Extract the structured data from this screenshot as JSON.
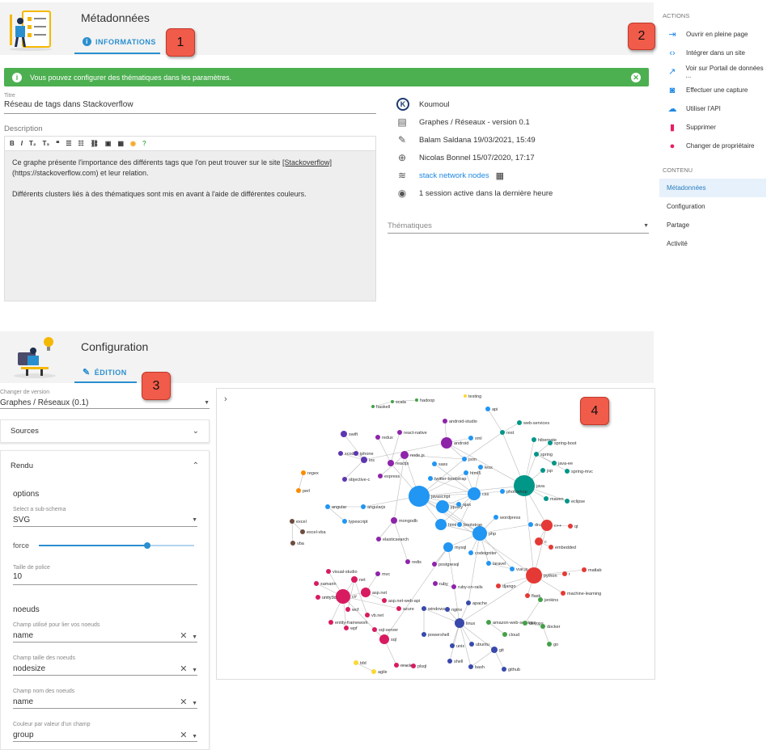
{
  "meta": {
    "header": {
      "title": "Métadonnées",
      "tab_label": "INFORMATIONS"
    },
    "callouts": [
      "1",
      "2",
      "3",
      "4"
    ],
    "alert": {
      "text": "Vous pouvez configurer des thématiques dans les paramètres."
    },
    "title_field": {
      "label": "Titre",
      "value": "Réseau de tags dans Stackoverflow"
    },
    "description": {
      "label": "Description",
      "toolbar": [
        "B",
        "I",
        "T₂",
        "T₃",
        "❝",
        "☰",
        "☷",
        "⛓",
        "▣",
        "▦",
        "◉",
        "?"
      ],
      "line1_before": "Ce graphe présente l'importance des différents tags que l'on peut trouver sur le site ",
      "line1_link": "[Stackoverflow]",
      "line1_after": "(https://stackoverflow.com) et leur relation.",
      "line2": "Différents clusters liés à des thématiques sont mis en avant à l'aide de différentes couleurs."
    },
    "info": {
      "owner": "Koumoul",
      "app": "Graphes / Réseaux - version 0.1",
      "updated": "Balam Saldana 19/03/2021, 15:49",
      "created": "Nicolas Bonnel 15/07/2020, 17:17",
      "dataset": "stack network nodes",
      "sessions": "1 session active dans la dernière heure",
      "thematiques_label": "Thématiques"
    }
  },
  "right": {
    "actions_header": "ACTIONS",
    "actions": [
      {
        "label": "Ouvrir en pleine page",
        "icon": "open-icon",
        "color": "#1e88e5"
      },
      {
        "label": "Intégrer dans un site",
        "icon": "code-icon",
        "color": "#1e88e5"
      },
      {
        "label": "Voir sur Portail de données ...",
        "icon": "external-link-icon",
        "color": "#1e88e5"
      },
      {
        "label": "Effectuer une capture",
        "icon": "camera-icon",
        "color": "#1e88e5"
      },
      {
        "label": "Utiliser l'API",
        "icon": "cloud-icon",
        "color": "#1e88e5"
      },
      {
        "label": "Supprimer",
        "icon": "delete-icon",
        "color": "#e91e63"
      },
      {
        "label": "Changer de propriétaire",
        "icon": "person-icon",
        "color": "#e91e63"
      }
    ],
    "content_header": "CONTENU",
    "content": [
      "Métadonnées",
      "Configuration",
      "Partage",
      "Activité"
    ]
  },
  "config": {
    "header": {
      "title": "Configuration",
      "tab_label": "ÉDITION"
    },
    "version": {
      "label": "Changer de version",
      "value": "Graphes / Réseaux (0.1)"
    },
    "sources_label": "Sources",
    "rendu_label": "Rendu",
    "options_label": "options",
    "subschema": {
      "label": "Select a sub-schema",
      "value": "SVG"
    },
    "force": {
      "label": "force",
      "level": 0.7
    },
    "font_size": {
      "label": "Taille de police",
      "value": "10"
    },
    "nodes_label": "noeuds",
    "field_link": {
      "label": "Champ utilisé pour lier vos noeuds",
      "value": "name"
    },
    "field_size": {
      "label": "Champ taille des noeuds",
      "value": "nodesize"
    },
    "field_name": {
      "label": "Champ nom des noeuds",
      "value": "name"
    },
    "field_color": {
      "label": "Couleur par valeur d'un champ",
      "value": "group"
    }
  },
  "graph": {
    "colors": {
      "web": "#2196f3",
      "front": "#8e24aa",
      "java": "#009688",
      "python": "#e53935",
      "dotnet": "#d81b60",
      "linux": "#3949ab",
      "cloud": "#43a047",
      "misc": "#fdd835",
      "gray": "#6d4c41",
      "ios": "#5e35b1",
      "orange": "#fb8c00"
    },
    "nodes": [
      {
        "name": "testing",
        "g": "misc"
      },
      {
        "name": "haskell",
        "g": "cloud"
      },
      {
        "name": "scala",
        "g": "cloud"
      },
      {
        "name": "hadoop",
        "g": "cloud"
      },
      {
        "name": "api",
        "g": "web"
      },
      {
        "name": "android-studio",
        "g": "front"
      },
      {
        "name": "web-services",
        "g": "java"
      },
      {
        "name": "swift",
        "g": "ios"
      },
      {
        "name": "react-native",
        "g": "front"
      },
      {
        "name": "xml",
        "g": "web"
      },
      {
        "name": "rest",
        "g": "java"
      },
      {
        "name": "redux",
        "g": "front"
      },
      {
        "name": "android",
        "g": "front"
      },
      {
        "name": "hibernate",
        "g": "java"
      },
      {
        "name": "spring-boot",
        "g": "java"
      },
      {
        "name": "xcode",
        "g": "ios"
      },
      {
        "name": "iphone",
        "g": "ios"
      },
      {
        "name": "node.js",
        "g": "front"
      },
      {
        "name": "json",
        "g": "web"
      },
      {
        "name": "spring",
        "g": "java"
      },
      {
        "name": "ios",
        "g": "ios"
      },
      {
        "name": "reactjs",
        "g": "front"
      },
      {
        "name": "sass",
        "g": "web"
      },
      {
        "name": "less",
        "g": "web"
      },
      {
        "name": "java-ee",
        "g": "java"
      },
      {
        "name": "html5",
        "g": "web"
      },
      {
        "name": "jsp",
        "g": "java"
      },
      {
        "name": "spring-mvc",
        "g": "java"
      },
      {
        "name": "regex",
        "g": "orange"
      },
      {
        "name": "objective-c",
        "g": "ios"
      },
      {
        "name": "express",
        "g": "front"
      },
      {
        "name": "twitter-bootstrap",
        "g": "web"
      },
      {
        "name": "java",
        "g": "java"
      },
      {
        "name": "css",
        "g": "web"
      },
      {
        "name": "photoshop",
        "g": "web"
      },
      {
        "name": "perl",
        "g": "orange"
      },
      {
        "name": "javascript",
        "g": "web"
      },
      {
        "name": "jquery",
        "g": "web"
      },
      {
        "name": "maven",
        "g": "java"
      },
      {
        "name": "eclipse",
        "g": "java"
      },
      {
        "name": "angular",
        "g": "web"
      },
      {
        "name": "angularjs",
        "g": "web"
      },
      {
        "name": "ajax",
        "g": "web"
      },
      {
        "name": "wordpress",
        "g": "web"
      },
      {
        "name": "excel",
        "g": "gray"
      },
      {
        "name": "typescript",
        "g": "web"
      },
      {
        "name": "mongodb",
        "g": "front"
      },
      {
        "name": "html",
        "g": "web"
      },
      {
        "name": "bootstrap",
        "g": "web"
      },
      {
        "name": "drupal",
        "g": "web"
      },
      {
        "name": "c++",
        "g": "python"
      },
      {
        "name": "qt",
        "g": "python"
      },
      {
        "name": "excel-vba",
        "g": "gray"
      },
      {
        "name": "php",
        "g": "web"
      },
      {
        "name": "elasticsearch",
        "g": "front"
      },
      {
        "name": "c",
        "g": "python"
      },
      {
        "name": "vba",
        "g": "gray"
      },
      {
        "name": "mysql",
        "g": "web"
      },
      {
        "name": "embedded",
        "g": "python"
      },
      {
        "name": "codeigniter",
        "g": "web"
      },
      {
        "name": "redis",
        "g": "front"
      },
      {
        "name": "postgresql",
        "g": "front"
      },
      {
        "name": "laravel",
        "g": "web"
      },
      {
        "name": "visual-studio",
        "g": "dotnet"
      },
      {
        "name": "net",
        "g": "dotnet"
      },
      {
        "name": "mvc",
        "g": "front"
      },
      {
        "name": "vue.js",
        "g": "web"
      },
      {
        "name": "python",
        "g": "python"
      },
      {
        "name": "matlab",
        "g": "python"
      },
      {
        "name": "r",
        "g": "python"
      },
      {
        "name": "xamarin",
        "g": "dotnet"
      },
      {
        "name": "ruby",
        "g": "front"
      },
      {
        "name": "ruby-on-rails",
        "g": "front"
      },
      {
        "name": "django",
        "g": "python"
      },
      {
        "name": "machine-learning",
        "g": "python"
      },
      {
        "name": "asp.net",
        "g": "dotnet"
      },
      {
        "name": "asp.net-web-api",
        "g": "dotnet"
      },
      {
        "name": "flask",
        "g": "python"
      },
      {
        "name": "unity3d",
        "g": "dotnet"
      },
      {
        "name": "c#",
        "g": "dotnet"
      },
      {
        "name": "azure",
        "g": "dotnet"
      },
      {
        "name": "apache",
        "g": "linux"
      },
      {
        "name": "jenkins",
        "g": "cloud"
      },
      {
        "name": "wcf",
        "g": "dotnet"
      },
      {
        "name": "vb.net",
        "g": "dotnet"
      },
      {
        "name": "windows",
        "g": "linux"
      },
      {
        "name": "nginx",
        "g": "linux"
      },
      {
        "name": "entity-framework",
        "g": "dotnet"
      },
      {
        "name": "linux",
        "g": "linux"
      },
      {
        "name": "amazon-web-services",
        "g": "cloud"
      },
      {
        "name": "devops",
        "g": "cloud"
      },
      {
        "name": "docker",
        "g": "cloud"
      },
      {
        "name": "wpf",
        "g": "dotnet"
      },
      {
        "name": "sql-server",
        "g": "dotnet"
      },
      {
        "name": "powershell",
        "g": "linux"
      },
      {
        "name": "cloud",
        "g": "cloud"
      },
      {
        "name": "go",
        "g": "cloud"
      },
      {
        "name": "unix",
        "g": "linux"
      },
      {
        "name": "ubuntu",
        "g": "linux"
      },
      {
        "name": "sql",
        "g": "dotnet"
      },
      {
        "name": "git",
        "g": "linux"
      },
      {
        "name": "tdd",
        "g": "misc"
      },
      {
        "name": "shell",
        "g": "linux"
      },
      {
        "name": "bash",
        "g": "linux"
      },
      {
        "name": "oracle",
        "g": "dotnet"
      },
      {
        "name": "plsql",
        "g": "dotnet"
      },
      {
        "name": "github",
        "g": "linux"
      },
      {
        "name": "agile",
        "g": "misc"
      }
    ]
  }
}
